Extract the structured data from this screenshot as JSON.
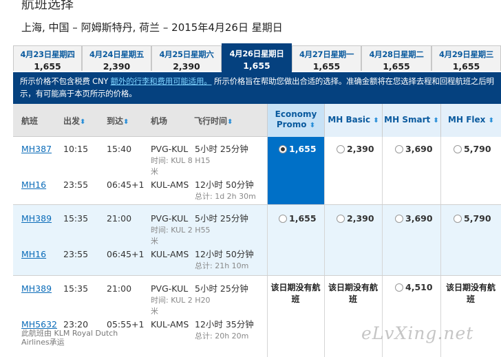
{
  "page": {
    "title": "航班选择",
    "route": "上海, 中国 – 阿姆斯特丹, 荷兰 – 2015年4月26日 星期日"
  },
  "date_tabs": [
    {
      "date": "4月23日星期四",
      "price": "1,655"
    },
    {
      "date": "4月24日星期五",
      "price": "2,390"
    },
    {
      "date": "4月25日星期六",
      "price": "2,390"
    },
    {
      "date": "4月26日星期日",
      "price": "1,655",
      "active": true
    },
    {
      "date": "4月27日星期一",
      "price": "1,655"
    },
    {
      "date": "4月28日星期二",
      "price": "1,655"
    },
    {
      "date": "4月29日星期三",
      "price": "1,655"
    }
  ],
  "notice": {
    "text1": "所示价格不包含税费 CNY ",
    "link": "额外的行李和费用可能适用。",
    "text2": " 所示价格旨在帮助您做出合适的选择。准确金额将在您选择去程和回程航班之后明示，有可能高于本页所示的价格。"
  },
  "headers": {
    "flight": "航班",
    "depart": "出发",
    "arrive": "到达",
    "airport": "机场",
    "duration": "飞行时间",
    "fare1_line1": "Economy",
    "fare1_line2": "Promo",
    "fare2": "MH Basic",
    "fare3": "MH Smart",
    "fare4": "MH Flex",
    "sort_icon": "⬍"
  },
  "rows": [
    {
      "seg1": {
        "flight": "MH387",
        "dep": "10:15",
        "arr": "15:40",
        "airport": "PVG-KUL",
        "dur": "5小时 25分钟"
      },
      "layover_a": "时间: KUL 8 H15",
      "layover_b": "米",
      "seg2": {
        "flight": "MH16",
        "dep": "23:55",
        "arr": "06:45+1",
        "airport": "KUL-AMS",
        "dur": "12小时 50分钟"
      },
      "total": "总计: 1d 2h 30m",
      "fares": [
        "1,655",
        "2,390",
        "3,690",
        "5,790"
      ]
    },
    {
      "seg1": {
        "flight": "MH389",
        "dep": "15:35",
        "arr": "21:00",
        "airport": "PVG-KUL",
        "dur": "5小时 25分钟"
      },
      "layover_a": "时间: KUL 2 H55",
      "layover_b": "米",
      "seg2": {
        "flight": "MH16",
        "dep": "23:55",
        "arr": "06:45+1",
        "airport": "KUL-AMS",
        "dur": "12小时 50分钟"
      },
      "total": "总计: 21h 10m",
      "fares": [
        "1,655",
        "2,390",
        "3,690",
        "5,790"
      ]
    },
    {
      "seg1": {
        "flight": "MH389",
        "dep": "15:35",
        "arr": "21:00",
        "airport": "PVG-KUL",
        "dur": "5小时 25分钟"
      },
      "layover_a": "时间: KUL 2 H20",
      "layover_b": "米",
      "seg2": {
        "flight": "MH5632",
        "dep": "23:20",
        "arr": "05:55+1",
        "airport": "KUL-AMS",
        "dur": "12小时 35分钟"
      },
      "total": "总计: 20h 20m",
      "operated": "此航班由 KLM Royal Dutch Airlines承运",
      "na_text": "该日期没有航班",
      "fare3": "4,510"
    }
  ],
  "watermark": "eLvXing.net",
  "colors": {
    "brand": "#05417f",
    "selected": "#0070c7",
    "link": "#0a6bb8"
  }
}
